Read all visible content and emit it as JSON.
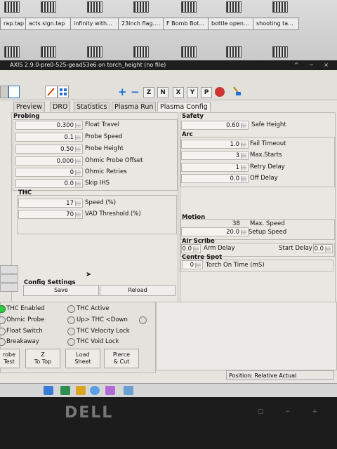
{
  "desktop": {
    "taskbar_items": [
      "rap.tap",
      "acts sign.tap",
      "infinity with...",
      "23inch flag....",
      "F Bomb Bot...",
      "bottle open...",
      "shooting ta..."
    ]
  },
  "window": {
    "title": "AXIS 2.9.0-pre0-525-gead53e6 on torch_height (no file)",
    "buttons": "^ − ×"
  },
  "toolbar": {
    "view_buttons": [
      "Z",
      "N",
      "X",
      "Y",
      "P"
    ]
  },
  "tabs": [
    "Preview",
    "DRO",
    "Statistics",
    "Plasma Run",
    "Plasma Config"
  ],
  "active_tab": "Plasma Config",
  "probing": {
    "title": "Probing",
    "rows": [
      {
        "value": "0.300",
        "label": "Float Travel"
      },
      {
        "value": "0.1",
        "label": "Probe Speed"
      },
      {
        "value": "0.50",
        "label": "Probe Height"
      },
      {
        "value": "0.000",
        "label": "Ohmic Probe Offset"
      },
      {
        "value": "0",
        "label": "Ohmic Retries"
      },
      {
        "value": "0.0",
        "label": "Skip IHS"
      }
    ]
  },
  "thc": {
    "title": "THC",
    "rows": [
      {
        "value": "17",
        "label": "Speed (%)"
      },
      {
        "value": "70",
        "label": "VAD Threshold (%)"
      }
    ]
  },
  "safety": {
    "title": "Safety",
    "value": "0.60",
    "label": "Safe Height"
  },
  "arc": {
    "title": "Arc",
    "rows": [
      {
        "value": "1.0",
        "label": "Fail Timeout"
      },
      {
        "value": "3",
        "label": "Max.Starts"
      },
      {
        "value": "1",
        "label": "Retry Delay"
      },
      {
        "value": "0.0",
        "label": "Off Delay"
      }
    ]
  },
  "motion": {
    "title": "Motion",
    "max_speed_value": "38",
    "max_speed_label": "Max. Speed",
    "setup_speed_value": "20.0",
    "setup_speed_label": "Setup Speed"
  },
  "air_scribe": {
    "title": "Air Scribe",
    "arm_value": "0.0",
    "arm_label": "Arm Delay",
    "start_label": "Start Delay",
    "start_value": "0.0"
  },
  "centre_spot": {
    "title": "Centre Spot",
    "value": "0",
    "label": "Torch On Time (mS)"
  },
  "config_settings": {
    "title": "Config Settings",
    "save": "Save",
    "reload": "Reload"
  },
  "indicators_left": [
    {
      "label": "THC Enabled",
      "on": true
    },
    {
      "label": "Ohmic Probe",
      "on": false
    },
    {
      "label": "Float Switch",
      "on": false
    },
    {
      "label": "Breakaway",
      "on": false
    }
  ],
  "indicators_right": [
    {
      "label": "THC Active"
    },
    {
      "label": "Up> THC <Down"
    },
    {
      "label": "THC Velocity Lock"
    },
    {
      "label": "THC Void Lock"
    }
  ],
  "buttons": [
    {
      "line1": "robe",
      "line2": "Test"
    },
    {
      "line1": "Z",
      "line2": "To Top"
    },
    {
      "line1": "Load",
      "line2": "Sheet"
    },
    {
      "line1": "Pierce",
      "line2": "& Cut"
    }
  ],
  "status": {
    "position": "Position: Relative Actual"
  },
  "monitor": {
    "brand": "DELL"
  },
  "colors": {
    "led_on": "#2ecc40",
    "panel": "#e9e7e2",
    "toolbar_blue": "#1f6fd6"
  }
}
